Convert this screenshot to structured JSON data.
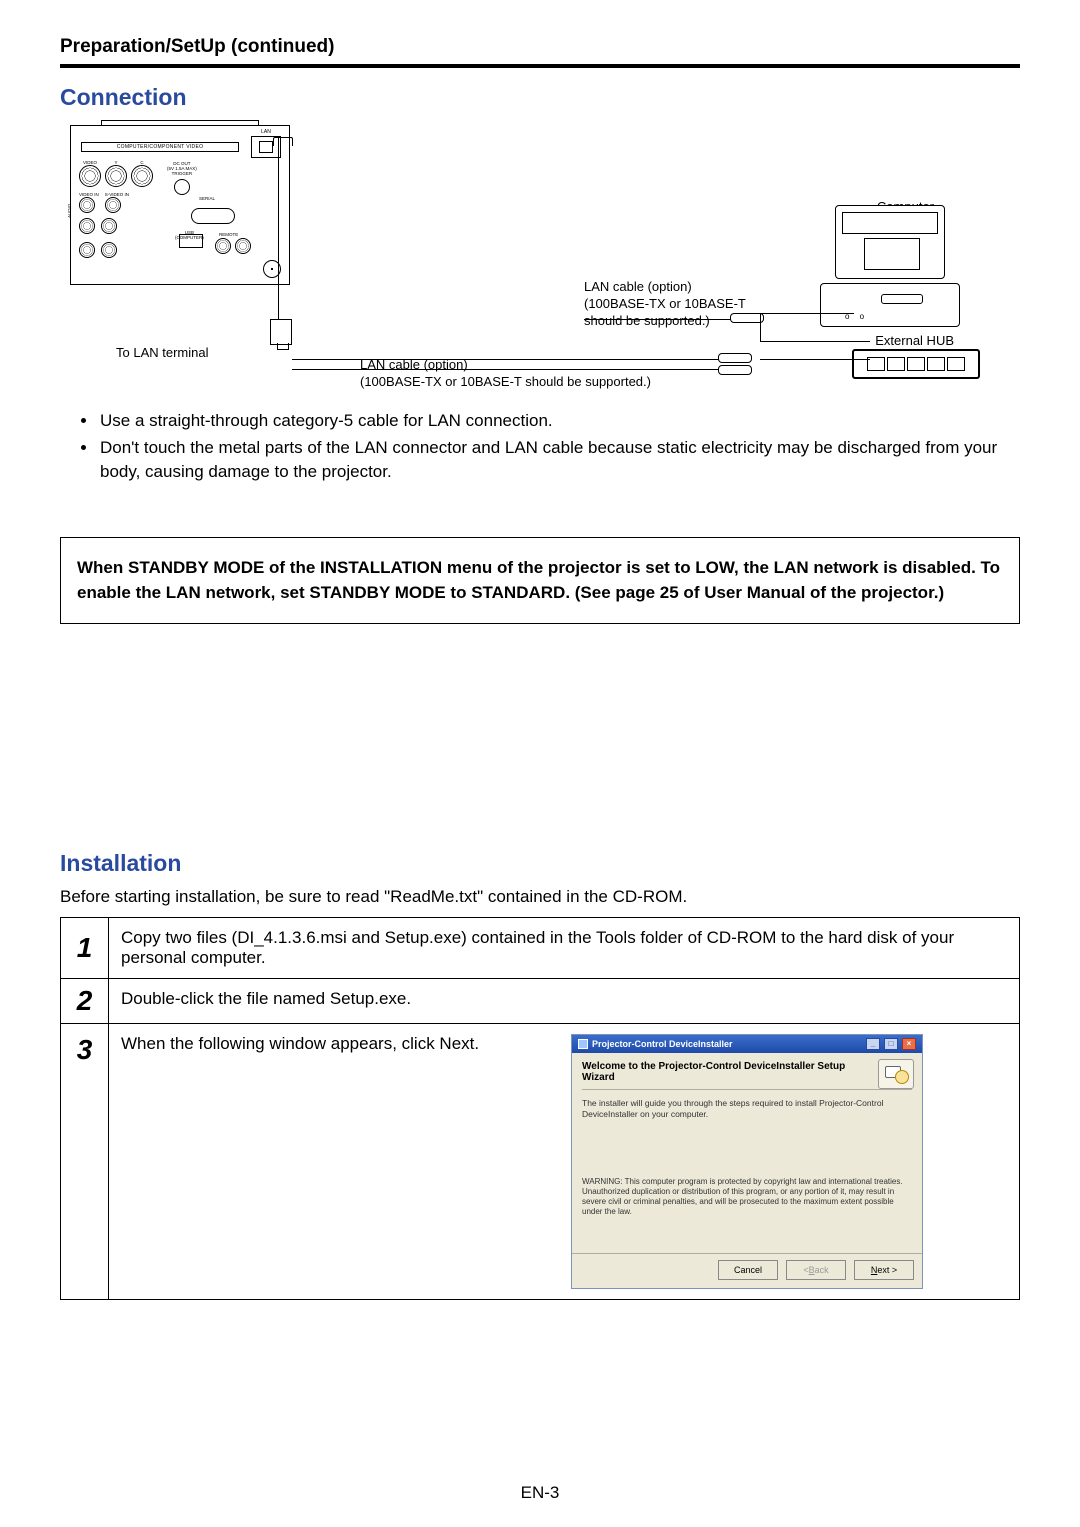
{
  "header": {
    "title": "Preparation/SetUp (continued)"
  },
  "connection": {
    "title": "Connection",
    "diagram": {
      "panel_strip": "COMPUTER/COMPONENT VIDEO",
      "lan_label": "LAN",
      "video_label": "VIDEO",
      "y_label": "Y",
      "c_label": "C",
      "dc_out": "DC OUT\n(5V 1.5A MAX)\nTRIGGER",
      "video_in": "VIDEO IN",
      "svideo_in": "S-VIDEO IN",
      "audio": "AUDIO",
      "serial": "SERIAL",
      "usb": "USB\n(COMPUTER)",
      "remote": "REMOTE",
      "to_lan_terminal": "To LAN terminal",
      "lan_cable_1": "LAN cable (option)\n(100BASE-TX or 10BASE-T should be supported.)",
      "lan_cable_2": "LAN cable (option)\n(100BASE-TX or 10BASE-T\nshould be supported.)",
      "computer": "Computer",
      "external_hub": "External HUB"
    },
    "bullets": [
      "Use a straight-through category-5 cable for LAN connection.",
      "Don't touch the metal parts of the LAN connector and LAN cable because static electricity may be discharged from your body, causing damage to the projector."
    ],
    "notice": "When STANDBY MODE of the INSTALLATION menu of the projector is set to LOW, the LAN network is disabled. To enable the LAN network, set STANDBY MODE to STANDARD. (See page 25 of User Manual of the projector.)"
  },
  "installation": {
    "title": "Installation",
    "intro": "Before starting installation, be sure to read \"ReadMe.txt\" contained in the CD-ROM.",
    "steps": [
      {
        "num": "1",
        "text": "Copy two files (DI_4.1.3.6.msi and Setup.exe) contained in the Tools folder of CD-ROM to the hard disk of your personal computer."
      },
      {
        "num": "2",
        "text": "Double-click the file named Setup.exe."
      },
      {
        "num": "3",
        "text": "When the following window appears, click Next."
      }
    ],
    "wizard": {
      "titlebar": "Projector-Control DeviceInstaller",
      "welcome": "Welcome to the Projector-Control DeviceInstaller Setup Wizard",
      "desc": "The installer will guide you through the steps required to install Projector-Control DeviceInstaller on your computer.",
      "warning": "WARNING: This computer program is protected by copyright law and international treaties. Unauthorized duplication or distribution of this program, or any portion of it, may result in severe civil or criminal penalties, and will be prosecuted to the maximum extent possible under the law.",
      "cancel": "Cancel",
      "back_prefix": "< ",
      "back_u": "B",
      "back_rest": "ack",
      "next_u": "N",
      "next_rest": "ext >"
    }
  },
  "page_number": "EN-3"
}
